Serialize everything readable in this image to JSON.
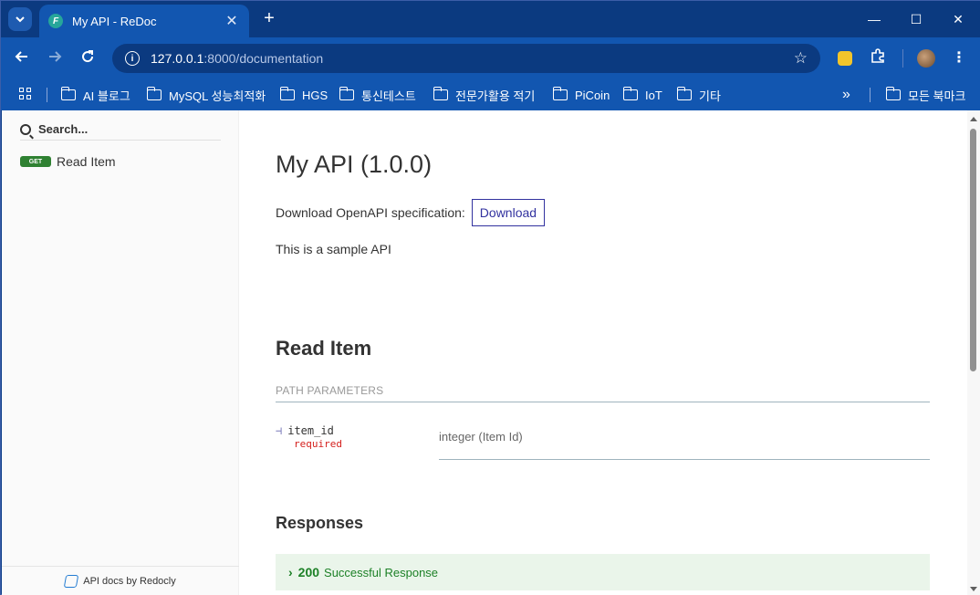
{
  "browser": {
    "tab_title": "My API - ReDoc",
    "tab_close": "✕",
    "new_tab": "+",
    "favicon": "F",
    "url_host": "127.0.0.1",
    "url_path": ":8000/documentation",
    "window_controls": {
      "minimize": "—",
      "maximize": "☐",
      "close": "✕"
    }
  },
  "bookmarks": [
    {
      "label": "AI 블로그"
    },
    {
      "label": "MySQL 성능최적화"
    },
    {
      "label": "HGS"
    },
    {
      "label": "통신테스트"
    },
    {
      "label": "전문가활용 적기"
    },
    {
      "label": "PiCoin"
    },
    {
      "label": "IoT"
    },
    {
      "label": "기타"
    }
  ],
  "bookmarks_overflow": "»",
  "bookmarks_all": "모든 북마크",
  "sidebar": {
    "search_placeholder": "Search...",
    "items": [
      {
        "method": "GET",
        "label": "Read Item"
      }
    ],
    "footer": "API docs by Redocly"
  },
  "doc": {
    "title": "My API (1.0.0)",
    "download_label": "Download OpenAPI specification:",
    "download_button": "Download",
    "description": "This is a sample API",
    "operation_title": "Read Item",
    "path_params_header": "Path Parameters",
    "params": [
      {
        "name": "item_id",
        "required": "required",
        "type": "integer (Item Id)"
      }
    ],
    "responses_title": "Responses",
    "responses": [
      {
        "code": "200",
        "description": "Successful Response"
      }
    ]
  },
  "colors": {
    "chrome_frame": "#0b3a80",
    "chrome_toolbar": "#1256b0",
    "get_badge": "#2f8132",
    "download_accent": "#32329f",
    "success_bg": "#eaf5ea",
    "success_text": "#1d8127",
    "required": "#d41f1c"
  }
}
